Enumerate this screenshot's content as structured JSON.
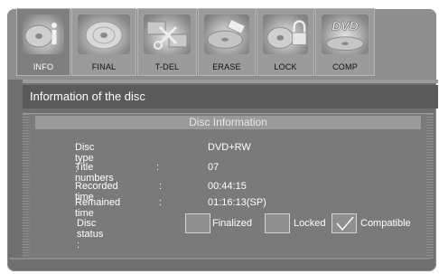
{
  "tabs": [
    {
      "label": "INFO",
      "icon": "info-disc-icon"
    },
    {
      "label": "FINAL",
      "icon": "final-disc-icon"
    },
    {
      "label": "T-DEL",
      "icon": "title-delete-icon"
    },
    {
      "label": "ERASE",
      "icon": "erase-disc-icon"
    },
    {
      "label": "LOCK",
      "icon": "lock-disc-icon"
    },
    {
      "label": "COMP",
      "icon": "dvd-compatible-icon"
    }
  ],
  "dvd_logo_text": "DVD",
  "header": {
    "title": "Information of the disc"
  },
  "panel": {
    "title": "Disc Information",
    "rows": [
      {
        "label": "Disc type :",
        "sep": "",
        "value": "DVD+RW"
      },
      {
        "label": "Title numbers",
        "sep": ":",
        "value": "07"
      },
      {
        "label": "Recorded time",
        "sep": ":",
        "value": "00:44:15"
      },
      {
        "label": "Remained time",
        "sep": ":",
        "value": "01:16:13(SP)"
      }
    ],
    "status": {
      "label": "Disc status :",
      "finalized": "Finalized",
      "locked": "Locked",
      "compatible": "Compatible"
    }
  },
  "colors": {
    "frame": "#6f6f6f",
    "header": "#5a5a5a",
    "panel": "#7a7a7a",
    "active_tab": "#7f7f7f"
  }
}
